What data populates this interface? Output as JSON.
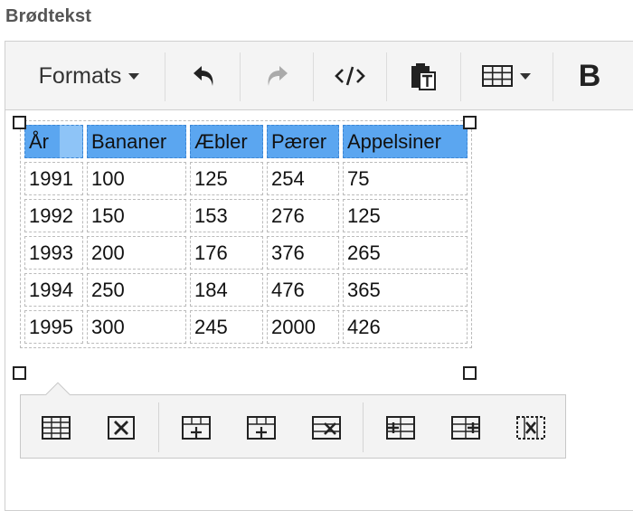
{
  "field": {
    "label": "Brødtekst"
  },
  "toolbar": {
    "formats_label": "Formats",
    "bold_label": "B",
    "icons": [
      "undo-icon",
      "redo-icon",
      "source-code-icon",
      "paste-as-text-icon",
      "table-icon",
      "bold-icon"
    ]
  },
  "table": {
    "header": [
      "År",
      "Bananer",
      "Æbler",
      "Pærer",
      "Appelsiner"
    ],
    "rows": [
      [
        "1991",
        "100",
        "125",
        "254",
        "75"
      ],
      [
        "1992",
        "150",
        "153",
        "276",
        "125"
      ],
      [
        "1993",
        "200",
        "176",
        "376",
        "265"
      ],
      [
        "1994",
        "250",
        "184",
        "476",
        "365"
      ],
      [
        "1995",
        "300",
        "245",
        "2000",
        "426"
      ]
    ]
  },
  "table_toolbar": {
    "icons": [
      "table-properties-icon",
      "delete-table-icon",
      "insert-row-before-icon",
      "insert-row-after-icon",
      "delete-row-icon",
      "insert-column-before-icon",
      "insert-column-after-icon",
      "delete-column-icon"
    ]
  },
  "colors": {
    "header_selection": "#5ba6f0",
    "toolbar_bg": "#f4f4f4"
  }
}
